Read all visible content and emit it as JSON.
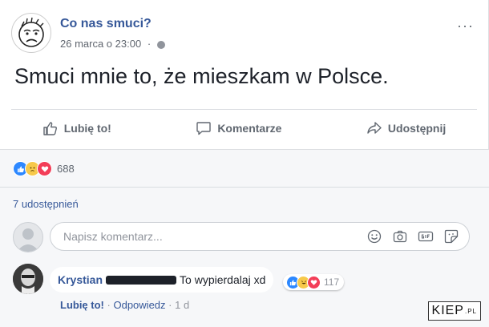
{
  "post": {
    "page_name": "Co nas smuci?",
    "date": "26 marca o 23:00",
    "separator": "·",
    "more_label": "···",
    "text": "Smuci mnie to, że mieszkam w Polsce."
  },
  "actions": {
    "like_label": "Lubię to!",
    "comment_label": "Komentarze",
    "share_label": "Udostępnij"
  },
  "stats": {
    "reaction_icons": [
      "like-icon",
      "sad-icon",
      "love-icon"
    ],
    "reaction_count": "688",
    "shares_label": "7 udostępnień"
  },
  "composer": {
    "placeholder": "Napisz komentarz...",
    "icons": [
      "emoji-icon",
      "camera-icon",
      "gif-icon",
      "sticker-icon"
    ]
  },
  "comment": {
    "author": "Krystian",
    "text": "To wypierdalaj xd",
    "reaction_icons": [
      "like-icon",
      "haha-icon",
      "love-icon"
    ],
    "reaction_count": "117",
    "like_label": "Lubię to!",
    "separator": "·",
    "reply_label": "Odpowiedz",
    "time": "1 d"
  },
  "watermark": {
    "text": "KIEP",
    "suffix": ".PL"
  },
  "colors": {
    "link": "#365899",
    "like_blue": "#2d88ff",
    "love_red": "#f33e58",
    "sad_yellow": "#f7c94a"
  }
}
